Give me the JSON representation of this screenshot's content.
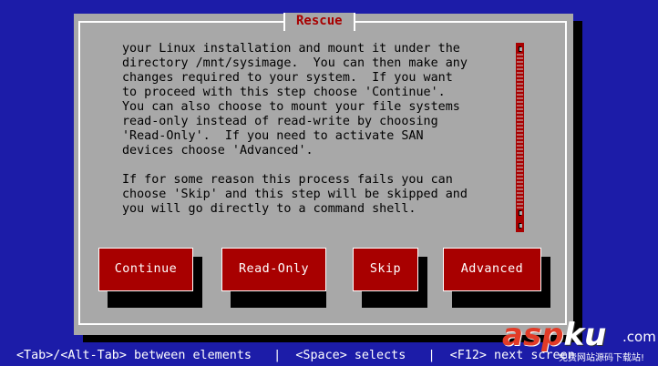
{
  "dialog": {
    "title": "Rescue",
    "body": "your Linux installation and mount it under the\ndirectory /mnt/sysimage.  You can then make any\nchanges required to your system.  If you want\nto proceed with this step choose 'Continue'.\nYou can also choose to mount your file systems\nread-only instead of read-write by choosing\n'Read-Only'.  If you need to activate SAN\ndevices choose 'Advanced'.\n\nIf for some reason this process fails you can\nchoose 'Skip' and this step will be skipped and\nyou will go directly to a command shell.",
    "buttons": {
      "continue": "Continue",
      "read_only": "Read-Only",
      "skip": "Skip",
      "advanced": "Advanced"
    }
  },
  "help_line": "<Tab>/<Alt-Tab> between elements   |  <Space> selects   |  <F12> next screen",
  "watermark": {
    "logo_part1": "asp",
    "logo_part2": "ku",
    "tld": ".com",
    "subtitle": "免费网站源码下载站!"
  },
  "colors": {
    "background": "#1c1ca8",
    "dialog": "#a8a8a8",
    "button": "#a80000",
    "title_text": "#a80000"
  }
}
